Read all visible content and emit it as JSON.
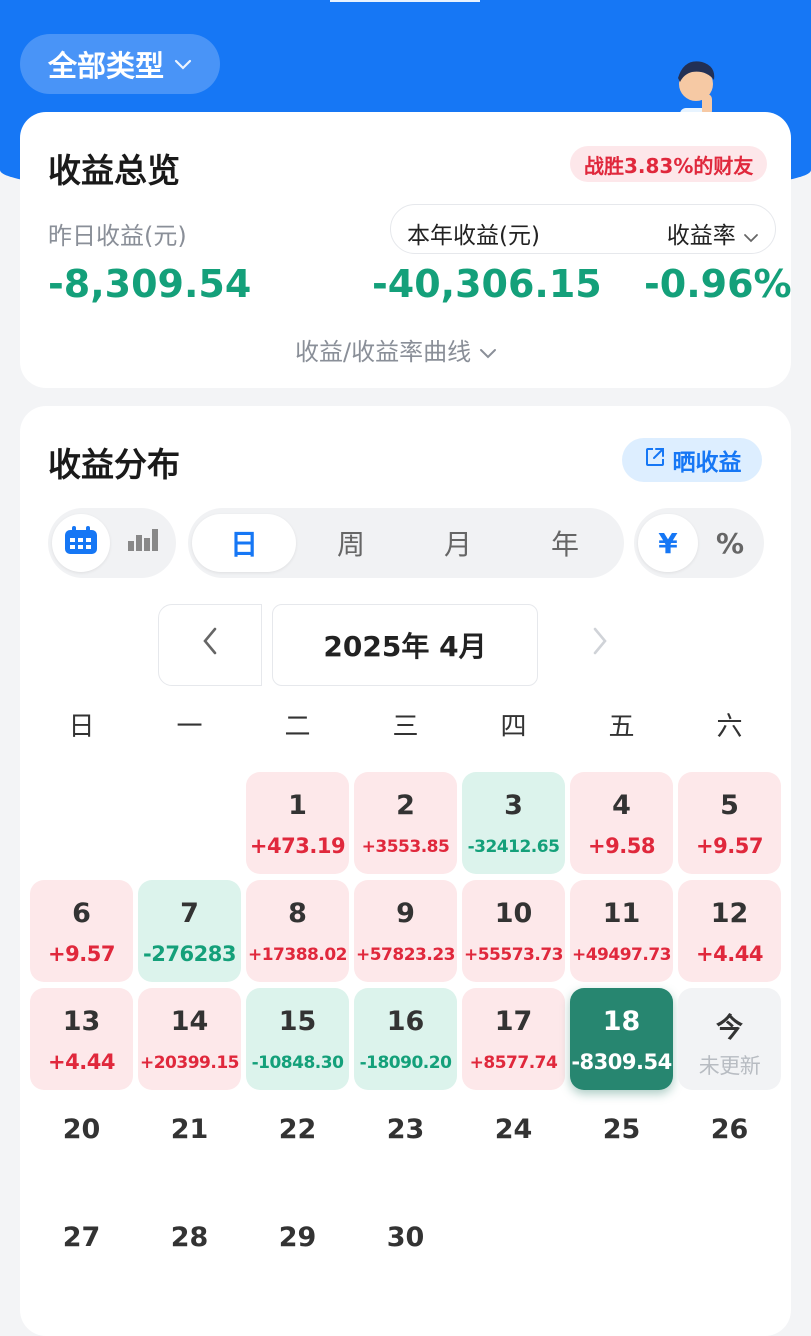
{
  "header": {
    "type_filter_label": "全部类型",
    "type_filter_icon": "chevron-down-icon",
    "brand_color": "#1677f5"
  },
  "overview": {
    "title": "收益总览",
    "beat_badge": "战胜3.83%的财友",
    "yesterday_label": "昨日收益(元)",
    "yesterday_value": "-8,309.54",
    "year_label": "本年收益(元)",
    "rate_label": "收益率",
    "year_value": "-40,306.15",
    "rate_value": "-0.96%",
    "curve_link": "收益/收益率曲线",
    "positive_color": "#e0283c",
    "negative_color": "#14a07a"
  },
  "distribution": {
    "title": "收益分布",
    "share_label": "晒收益",
    "view_toggle": {
      "calendar_icon": "calendar-icon",
      "bar_icon": "bar-chart-icon",
      "active": "calendar"
    },
    "period_tabs": [
      "日",
      "周",
      "月",
      "年"
    ],
    "period_active": "日",
    "unit_tabs": [
      "¥",
      "%"
    ],
    "unit_active": "¥",
    "month_label": "2025年 4月",
    "weekdays": [
      "日",
      "一",
      "二",
      "三",
      "四",
      "五",
      "六"
    ],
    "days": [
      {
        "d": "1",
        "v": "+473.19",
        "t": "pos"
      },
      {
        "d": "2",
        "v": "+3553.85",
        "t": "pos"
      },
      {
        "d": "3",
        "v": "-32412.65",
        "t": "neg"
      },
      {
        "d": "4",
        "v": "+9.58",
        "t": "pos"
      },
      {
        "d": "5",
        "v": "+9.57",
        "t": "pos"
      },
      {
        "d": "6",
        "v": "+9.57",
        "t": "pos"
      },
      {
        "d": "7",
        "v": "-276283",
        "t": "neg"
      },
      {
        "d": "8",
        "v": "+17388.02",
        "t": "pos"
      },
      {
        "d": "9",
        "v": "+57823.23",
        "t": "pos"
      },
      {
        "d": "10",
        "v": "+55573.73",
        "t": "pos"
      },
      {
        "d": "11",
        "v": "+49497.73",
        "t": "pos"
      },
      {
        "d": "12",
        "v": "+4.44",
        "t": "pos"
      },
      {
        "d": "13",
        "v": "+4.44",
        "t": "pos"
      },
      {
        "d": "14",
        "v": "+20399.15",
        "t": "pos"
      },
      {
        "d": "15",
        "v": "-10848.30",
        "t": "neg"
      },
      {
        "d": "16",
        "v": "-18090.20",
        "t": "neg"
      },
      {
        "d": "17",
        "v": "+8577.74",
        "t": "pos"
      },
      {
        "d": "18",
        "v": "-8309.54",
        "t": "sel"
      },
      {
        "d": "今",
        "v": "未更新",
        "t": "nodata"
      },
      {
        "d": "20",
        "v": "",
        "t": "plain"
      },
      {
        "d": "21",
        "v": "",
        "t": "plain"
      },
      {
        "d": "22",
        "v": "",
        "t": "plain"
      },
      {
        "d": "23",
        "v": "",
        "t": "plain"
      },
      {
        "d": "24",
        "v": "",
        "t": "plain"
      },
      {
        "d": "25",
        "v": "",
        "t": "plain"
      },
      {
        "d": "26",
        "v": "",
        "t": "plain"
      },
      {
        "d": "27",
        "v": "",
        "t": "plain"
      },
      {
        "d": "28",
        "v": "",
        "t": "plain"
      },
      {
        "d": "29",
        "v": "",
        "t": "plain"
      },
      {
        "d": "30",
        "v": "",
        "t": "plain"
      }
    ]
  }
}
